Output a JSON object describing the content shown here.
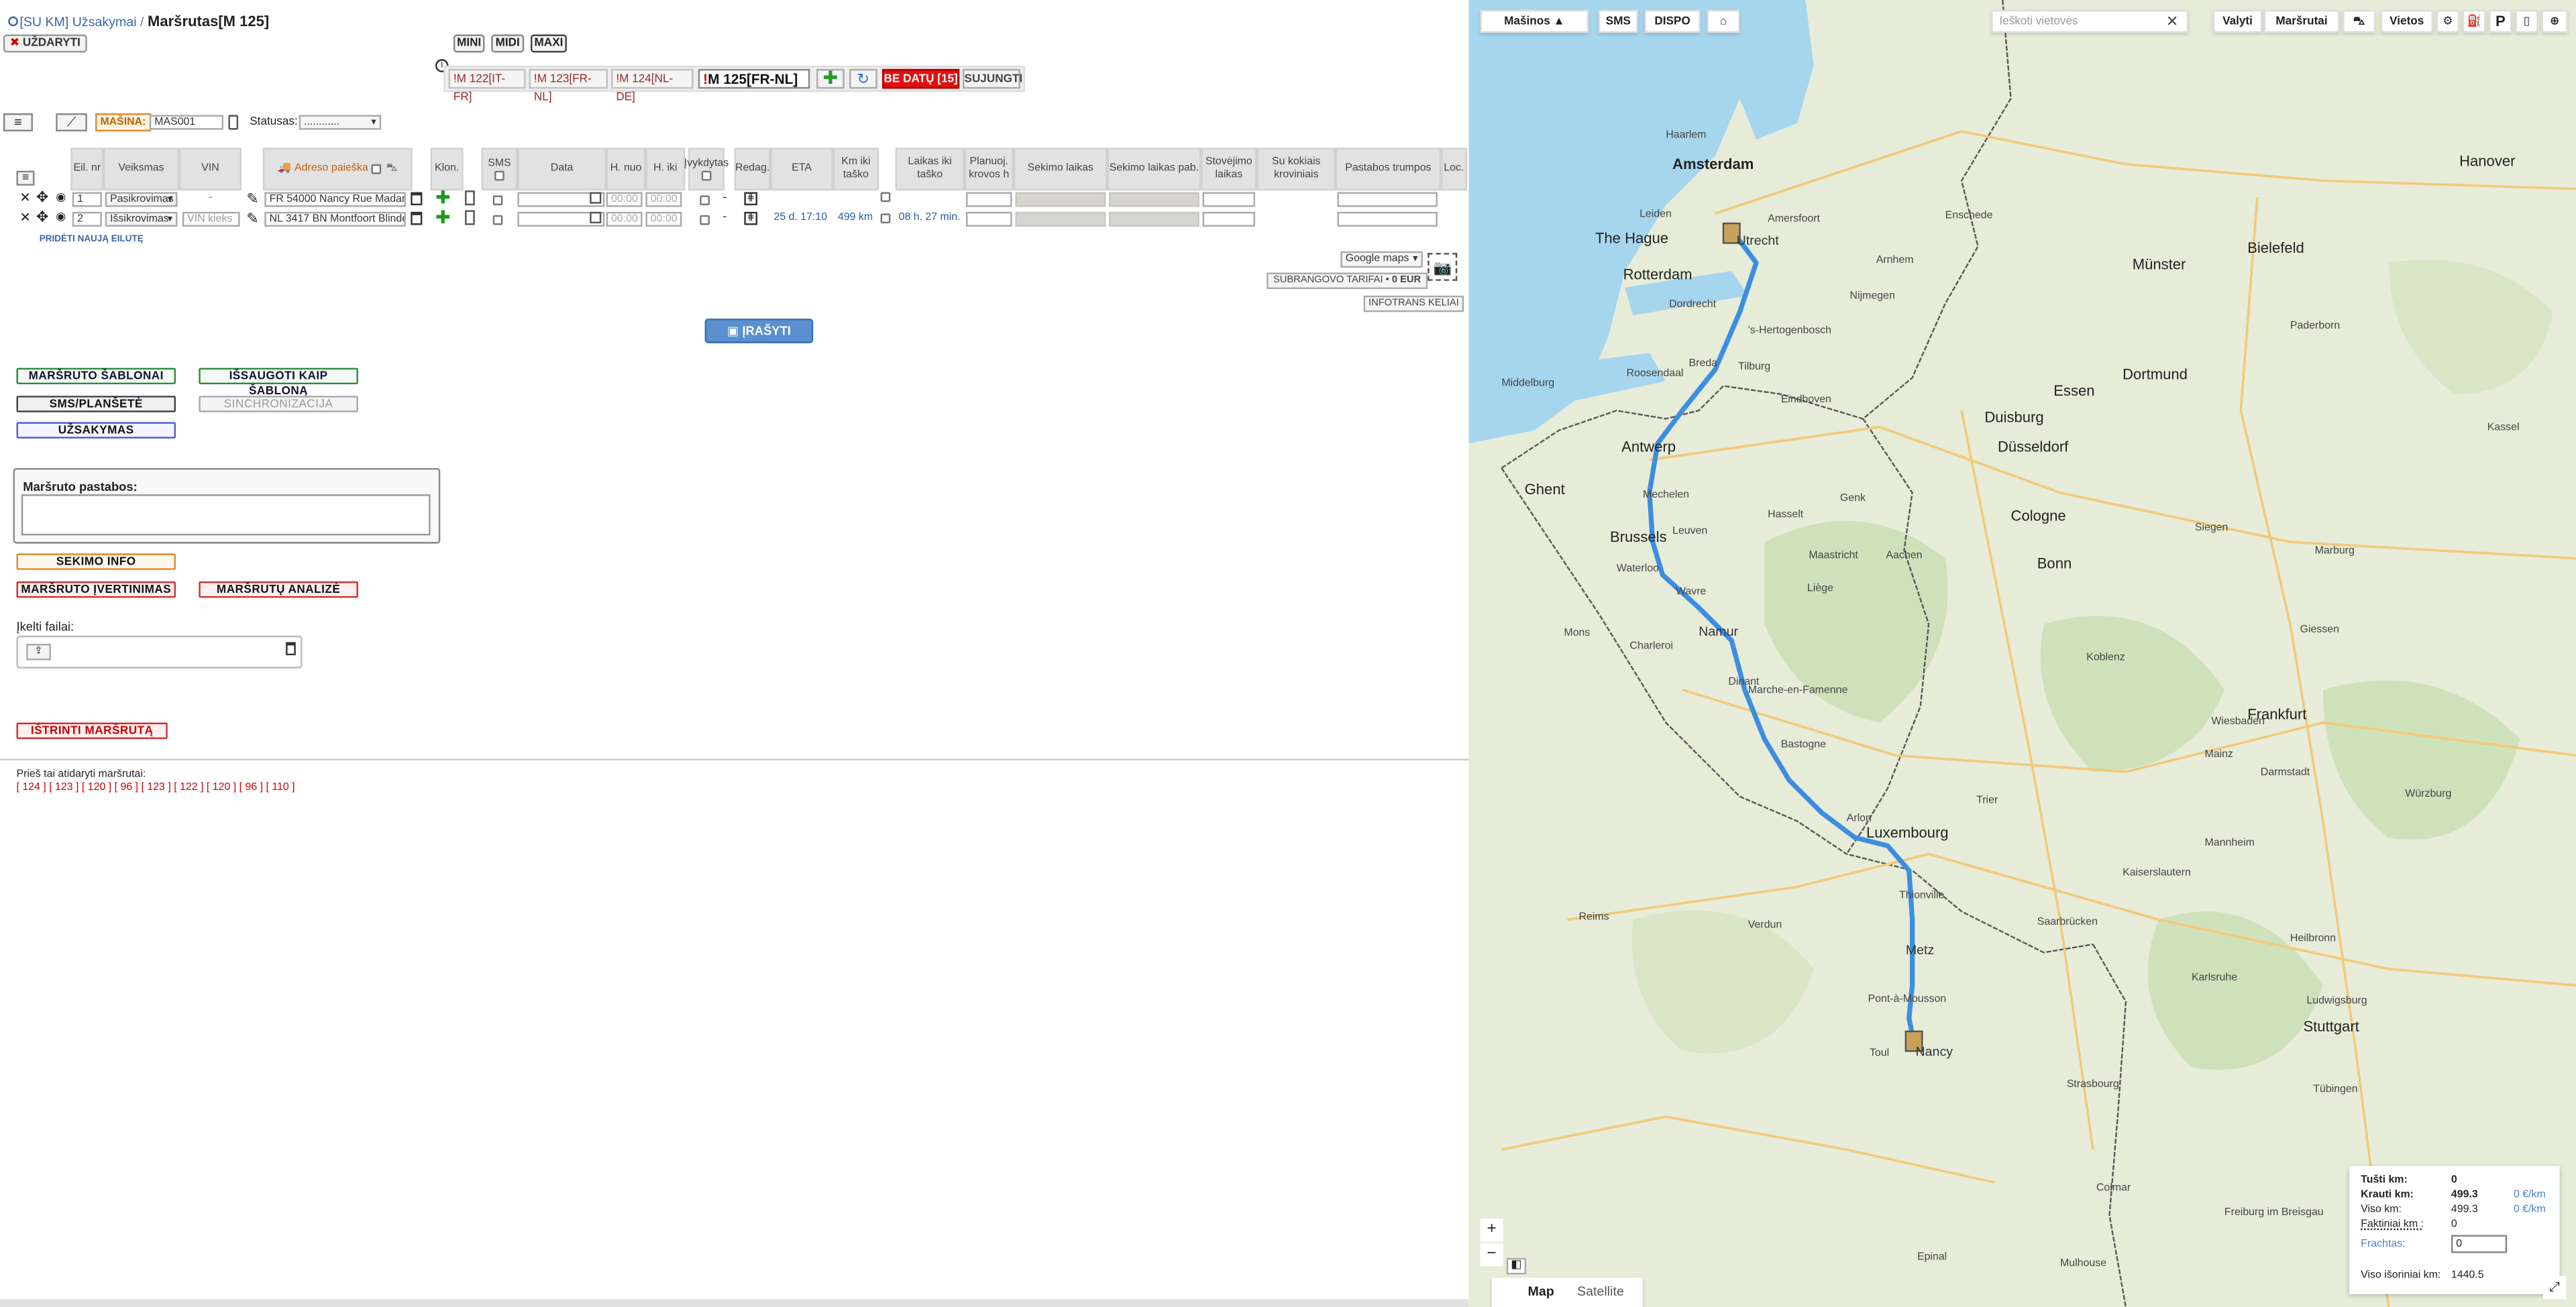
{
  "header": {
    "breadcrumb_link": "[SU KM] Užsakymai",
    "breadcrumb_sep": "/",
    "title": "Maršrutas[M 125]",
    "close_label": "UŽDARYTI"
  },
  "view_sizes": [
    "MINI",
    "MIDI",
    "MAXI"
  ],
  "route_tabs": [
    {
      "label": "M 122[IT-FR]"
    },
    {
      "label": "M 123[FR-NL]"
    },
    {
      "label": "M 124[NL-DE]"
    },
    {
      "label": "M 125[FR-NL]"
    }
  ],
  "route_controls": {
    "no_dates_label": "BE DATŲ [15]",
    "merge_label": "SUJUNGTI"
  },
  "vehicle_bar": {
    "machine_label": "MAŠINA:",
    "machine_value": "MAS001",
    "status_label": "Statusas:",
    "status_value": "............"
  },
  "table": {
    "headers": [
      "Eil. nr",
      "Veiksmas",
      "VIN",
      "Adreso paieška",
      "Klon.",
      "SMS",
      "Data",
      "H. nuo",
      "H. iki",
      "Įvykdytas",
      "Redag.",
      "ETA",
      "Km iki taško",
      "Laikas iki taško",
      "Planuoj. krovos h",
      "Sekimo laikas",
      "Sekimo laikas pab.",
      "Stovėjimo laikas",
      "Su kokiais kroviniais",
      "Pastabos trumpos",
      "Loc."
    ],
    "rows": [
      {
        "nr": "1",
        "action": "Pasikrovimas",
        "vin": "-",
        "address": "FR 54000 Nancy Rue Madame",
        "time_from": "00:00",
        "time_to": "00:00",
        "done": "-",
        "eta": "",
        "km": "",
        "time_to_point": ""
      },
      {
        "nr": "2",
        "action": "Išsikrovimas",
        "vin": "VIN kieks",
        "address": "NL 3417 BN Montfoort Blinde",
        "time_from": "00:00",
        "time_to": "00:00",
        "done": "-",
        "eta": "25 d. 17:10",
        "km": "499 km",
        "time_to_point": "08 h. 27 min."
      }
    ],
    "add_row_label": "PRIDĖTI NAUJĄ EILUTĘ"
  },
  "map_controls": {
    "provider": "Google maps",
    "subcontract_label": "SUBRANGOVO TARIFAI",
    "subcontract_value": "0 EUR",
    "infotrans_label": "INFOTRANS KELIAI"
  },
  "save_label": "ĮRAŠYTI",
  "actions": {
    "templates": "MARŠRUTO ŠABLONAI",
    "save_template": "IŠSAUGOTI KAIP ŠABLONĄ",
    "sms_tablet": "SMS/PLANŠETĖ",
    "sync": "SINCHRONIZACIJA",
    "order": "UŽSAKYMAS",
    "tracking_info": "SEKIMO INFO",
    "route_evaluation": "MARŠRUTO ĮVERTINIMAS",
    "route_analysis": "MARŠRUTŲ ANALIZĖ",
    "delete_route": "IŠTRINTI MARŠRUTĄ"
  },
  "notes_label": "Maršruto pastabos:",
  "upload_label": "Įkelti failai:",
  "history": {
    "label": "Prieš tai atidaryti maršrutai:",
    "items": [
      "[ 124 ]",
      "[ 123 ]",
      "[ 120 ]",
      "[ 96 ]",
      "[ 123 ]",
      "[ 122 ]",
      "[ 120 ]",
      "[ 96 ]",
      "[ 110 ]"
    ]
  },
  "map": {
    "toolbar": [
      "Mašinos ▲",
      "SMS",
      "DISPO"
    ],
    "search_placeholder": "Ieškoti vietovės",
    "right_buttons": [
      "Valyti",
      "Maršrutai",
      "Vietos"
    ],
    "view_tabs": [
      "Map",
      "Satellite"
    ],
    "cities": [
      "Amsterdam",
      "Utrecht",
      "The Hague",
      "Rotterdam",
      "Dordrecht",
      "Breda",
      "Tilburg",
      "'s-Hertogenbosch",
      "Nijmegen",
      "Arnhem",
      "Eindhoven",
      "Antwerp",
      "Ghent",
      "Brussels",
      "Leuven",
      "Maastricht",
      "Liège",
      "Aachen",
      "Namur",
      "Charleroi",
      "Mons",
      "Dinant",
      "Marche-en-Famenne",
      "Bastogne",
      "Arlon",
      "Luxembourg",
      "Thionville",
      "Metz",
      "Nancy",
      "Toul",
      "Pont-à-Mousson",
      "Essen",
      "Duisburg",
      "Düsseldorf",
      "Dortmund",
      "Cologne",
      "Bonn",
      "Koblenz",
      "Trier",
      "Frankfurt",
      "Wiesbaden",
      "Mainz",
      "Darmstadt",
      "Mannheim",
      "Kaiserslautern",
      "Saarbrücken",
      "Karlsruhe",
      "Stuttgart",
      "Strasbourg",
      "Münster",
      "Bielefeld",
      "Hanover",
      "Kassel",
      "Paderborn",
      "Siegen",
      "Marburg",
      "Giessen",
      "Reims",
      "Verdun",
      "Epinal",
      "Colmar",
      "Freiburg im Breisgau",
      "Mulhouse",
      "Ludwigsburg",
      "Heilbronn",
      "Tübingen",
      "Würzburg",
      "Enschede",
      "Leiden",
      "Haarlem",
      "Amersfoort",
      "Middelburg",
      "Roosendaal",
      "Mechelen",
      "Hasselt",
      "Genk",
      "Waterloo",
      "Wavre",
      "Namur"
    ],
    "stats": {
      "empty_km_label": "Tušti km:",
      "empty_km": "0",
      "loaded_km_label": "Krauti km:",
      "loaded_km": "499.3",
      "loaded_rate": "0 €/km",
      "total_km_label": "Viso km:",
      "total_km": "499.3",
      "total_rate": "0 €/km",
      "actual_km_label": "Faktiniai km :",
      "actual_km": "0",
      "freight_label": "Frachtas:",
      "freight_value": "0",
      "external_km_label": "Viso išoriniai km:",
      "external_km": "1440.5"
    }
  }
}
